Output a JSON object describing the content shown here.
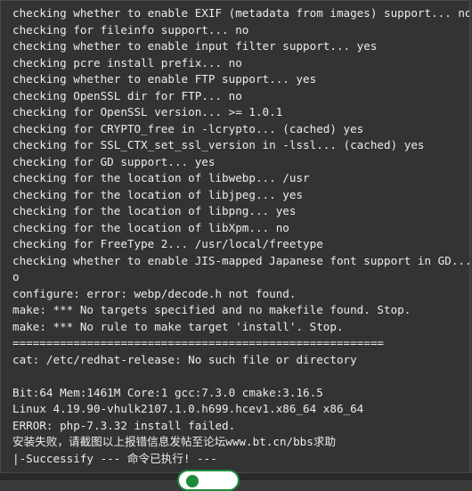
{
  "terminal": {
    "lines": [
      "checking whether to enable EXIF (metadata from images) support... no",
      "checking for fileinfo support... no",
      "checking whether to enable input filter support... yes",
      "checking pcre install prefix... no",
      "checking whether to enable FTP support... yes",
      "checking OpenSSL dir for FTP... no",
      "checking for OpenSSL version... >= 1.0.1",
      "checking for CRYPTO_free in -lcrypto... (cached) yes",
      "checking for SSL_CTX_set_ssl_version in -lssl... (cached) yes",
      "checking for GD support... yes",
      "checking for the location of libwebp... /usr",
      "checking for the location of libjpeg... yes",
      "checking for the location of libpng... yes",
      "checking for the location of libXpm... no",
      "checking for FreeType 2... /usr/local/freetype",
      "checking whether to enable JIS-mapped Japanese font support in GD... n",
      "o",
      "configure: error: webp/decode.h not found.",
      "make: *** No targets specified and no makefile found. Stop.",
      "make: *** No rule to make target 'install'. Stop.",
      "=======================================================",
      "cat: /etc/redhat-release: No such file or directory",
      "",
      "Bit:64 Mem:1461M Core:1 gcc:7.3.0 cmake:3.16.5",
      "Linux 4.19.90-vhulk2107.1.0.h699.hcev1.x86_64 x86_64",
      "ERROR: php-7.3.32 install failed.",
      "安装失败，请截图以上报错信息发帖至论坛www.bt.cn/bbs求助",
      "|-Successify --- 命令已执行! ---"
    ]
  }
}
